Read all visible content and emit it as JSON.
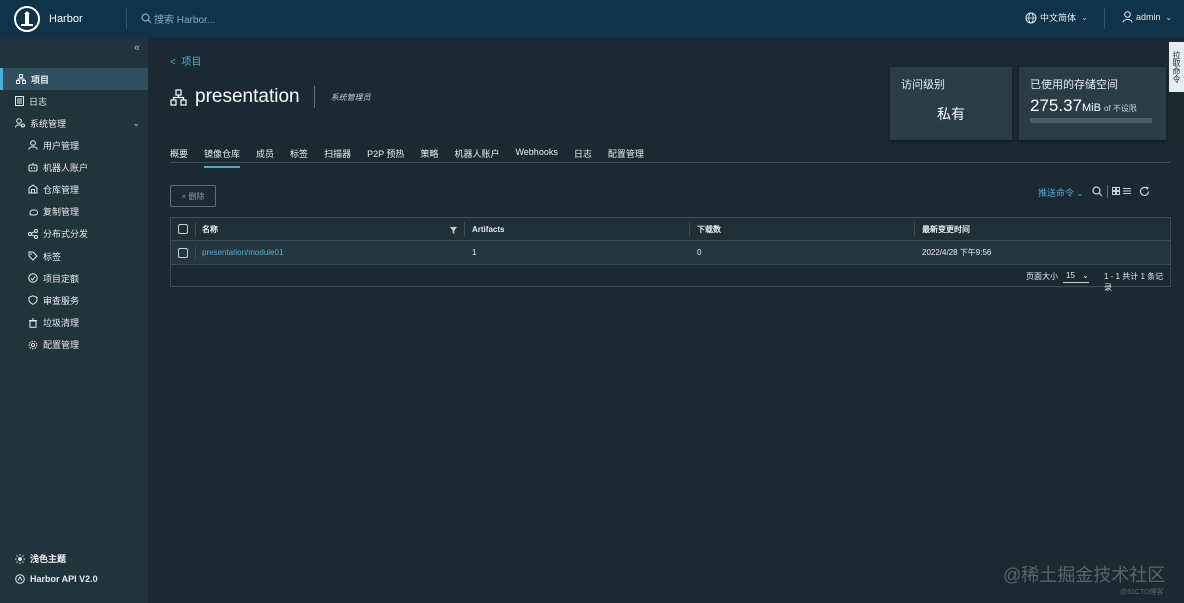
{
  "header": {
    "brand": "Harbor",
    "search_placeholder": "搜索 Harbor...",
    "language": "中文简体",
    "user": "admin"
  },
  "sidebar": {
    "items": [
      {
        "label": "项目",
        "icon": "project-icon"
      },
      {
        "label": "日志",
        "icon": "log-icon"
      },
      {
        "label": "系统管理",
        "icon": "admin-icon"
      }
    ],
    "sub_items": [
      {
        "label": "用户管理",
        "icon": "user-icon"
      },
      {
        "label": "机器人账户",
        "icon": "robot-icon"
      },
      {
        "label": "仓库管理",
        "icon": "registry-icon"
      },
      {
        "label": "复制管理",
        "icon": "replication-icon"
      },
      {
        "label": "分布式分发",
        "icon": "distribution-icon"
      },
      {
        "label": "标签",
        "icon": "tag-icon"
      },
      {
        "label": "项目定额",
        "icon": "quota-icon"
      },
      {
        "label": "审查服务",
        "icon": "shield-icon"
      },
      {
        "label": "垃圾清理",
        "icon": "trash-icon"
      },
      {
        "label": "配置管理",
        "icon": "gear-icon"
      }
    ],
    "theme": "浅色主题",
    "api": "Harbor API V2.0"
  },
  "breadcrumb": "项目",
  "project": {
    "name": "presentation",
    "role": "系统管理员"
  },
  "access_card": {
    "label": "访问级别",
    "value": "私有"
  },
  "storage_card": {
    "label": "已使用的存储空间",
    "value": "275.37",
    "unit": "MiB",
    "limit": "of 不设限"
  },
  "side_tab": "拉取命令",
  "tabs": [
    "概要",
    "镜像仓库",
    "成员",
    "标签",
    "扫描器",
    "P2P 预热",
    "策略",
    "机器人账户",
    "Webhooks",
    "日志",
    "配置管理"
  ],
  "toolbar": {
    "delete": "删除",
    "push_command": "推送命令"
  },
  "table": {
    "columns": [
      "名称",
      "Artifacts",
      "下载数",
      "最新变更时间"
    ],
    "rows": [
      {
        "name": "presentation/module01",
        "artifacts": "1",
        "pulls": "0",
        "updated": "2022/4/28 下午9:56"
      }
    ],
    "page_size_label": "页面大小",
    "page_size": "15",
    "summary": "1 - 1 共计 1 条记录"
  },
  "watermark": "@稀土掘金技术社区",
  "watermark_sub": "@51CTO博客",
  "colors": {
    "header_bg": "#0f3349",
    "sidebar_bg": "#21333b",
    "accent": "#49afd9",
    "content_bg": "#1b2a32"
  }
}
